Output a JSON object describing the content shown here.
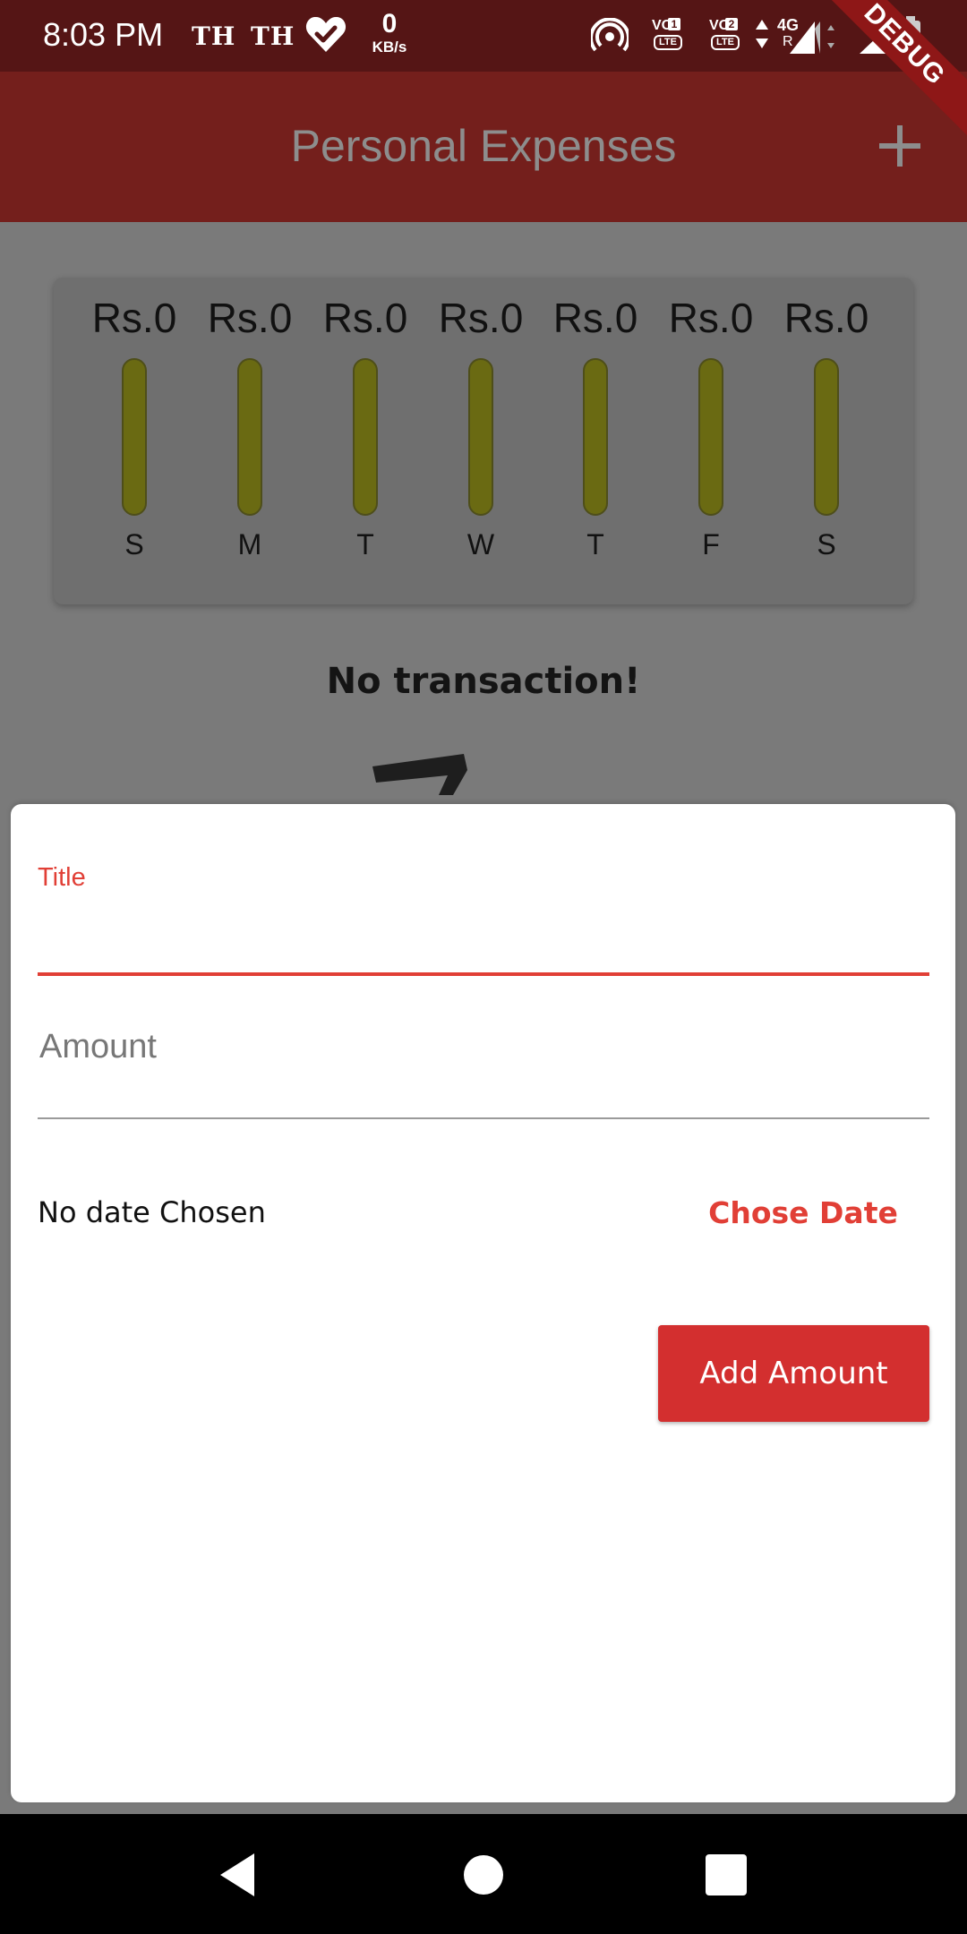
{
  "status_bar": {
    "time": "8:03 PM",
    "carrier_1": "TH",
    "carrier_2": "TH",
    "speed_value": "0",
    "speed_unit": "KB/s",
    "volte_1_label": "VO",
    "volte_1_sim": "1",
    "volte_2_label": "VO",
    "volte_2_sim": "2",
    "lte_label": "LTE",
    "network_label": "4G",
    "roaming_label": "R",
    "debug_label": "DEBUG"
  },
  "app_bar": {
    "title": "Personal Expenses",
    "add_icon": "plus-icon"
  },
  "chart": {
    "bars": [
      {
        "amount": "Rs.0",
        "day": "S",
        "fraction": 0
      },
      {
        "amount": "Rs.0",
        "day": "M",
        "fraction": 0
      },
      {
        "amount": "Rs.0",
        "day": "T",
        "fraction": 0
      },
      {
        "amount": "Rs.0",
        "day": "W",
        "fraction": 0
      },
      {
        "amount": "Rs.0",
        "day": "T",
        "fraction": 0
      },
      {
        "amount": "Rs.0",
        "day": "F",
        "fraction": 0
      },
      {
        "amount": "Rs.0",
        "day": "S",
        "fraction": 0
      }
    ]
  },
  "empty_state": {
    "message": "No transaction!"
  },
  "form": {
    "title_label": "Title",
    "title_value": "",
    "amount_placeholder": "Amount",
    "amount_value": "",
    "date_text": "No date Chosen",
    "chose_date_label": "Chose Date",
    "submit_label": "Add Amount"
  },
  "colors": {
    "accent": "#e13f36",
    "primary": "#d32f2f",
    "status_bar": "#551515",
    "app_bar": "#741f1c"
  },
  "nav_bar": {
    "back_icon": "back-triangle-icon",
    "home_icon": "home-circle-icon",
    "recents_icon": "recents-square-icon"
  }
}
